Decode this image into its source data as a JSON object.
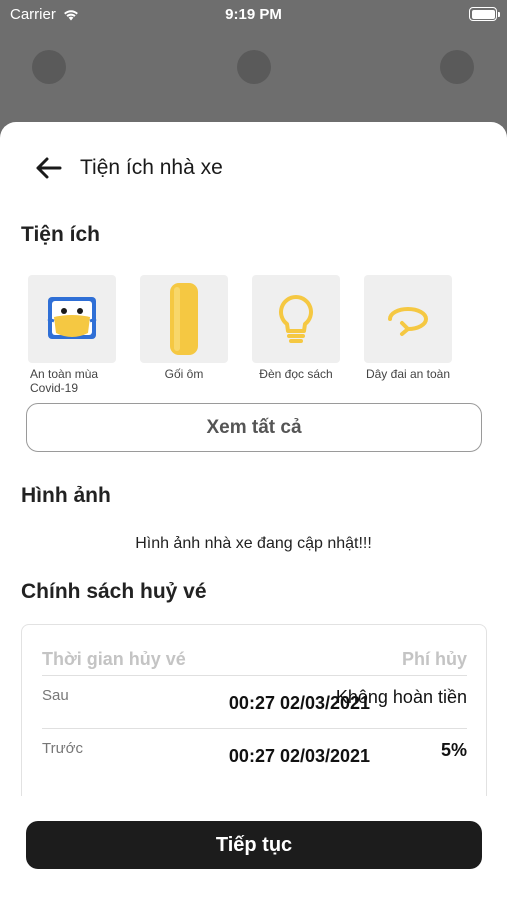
{
  "status_bar": {
    "carrier": "Carrier",
    "time": "9:19 PM",
    "battery_level": 1.0
  },
  "header": {
    "title": "Tiện ích nhà xe",
    "back_icon": "arrow-left-icon"
  },
  "amenities_section": {
    "title": "Tiện ích",
    "items": [
      {
        "label": "An toàn mùa Covid-19",
        "icon": "covid-mask-icon"
      },
      {
        "label": "Gối ôm",
        "icon": "pillow-icon"
      },
      {
        "label": "Đèn đọc sách",
        "icon": "lightbulb-icon"
      },
      {
        "label": "Dây đai an toàn",
        "icon": "seatbelt-icon"
      }
    ],
    "see_all_label": "Xem tất cả"
  },
  "images_section": {
    "title": "Hình ảnh",
    "message": "Hình ảnh nhà xe đang cập nhật!!!"
  },
  "cancellation_section": {
    "title": "Chính sách huỷ vé",
    "header_time": "Thời gian hủy vé",
    "header_fee": "Phí hủy",
    "rows": [
      {
        "prefix": "Sau",
        "time": "00:27 02/03/2021",
        "fee": "Không hoàn tiền"
      },
      {
        "prefix": "Trước",
        "time": "00:27 02/03/2021",
        "fee": "5%"
      }
    ]
  },
  "footer": {
    "continue_label": "Tiếp tục"
  },
  "colors": {
    "accent_yellow": "#F5C842",
    "primary_button": "#1C1C1C",
    "overlay": "#6E6E6E"
  }
}
